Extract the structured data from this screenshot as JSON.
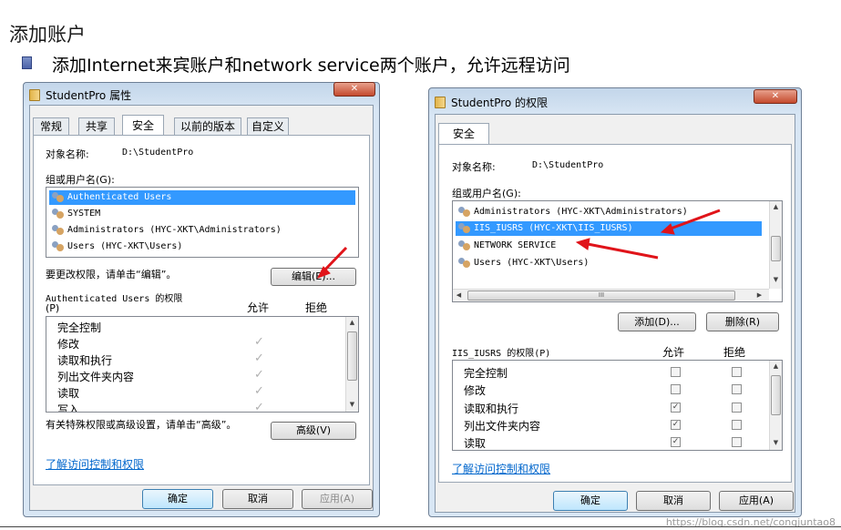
{
  "slide": {
    "title": "添加账户",
    "bullet": "添加Internet来宾账户和network service两个账户，允许远程访问"
  },
  "left_dialog": {
    "title": "StudentPro 属性",
    "close": "✕",
    "tabs": [
      "常规",
      "共享",
      "安全",
      "以前的版本",
      "自定义"
    ],
    "object_label": "对象名称:",
    "object_value": "D:\\StudentPro",
    "group_label": "组或用户名(G):",
    "users": [
      "Authenticated Users",
      "SYSTEM",
      "Administrators (HYC-XKT\\Administrators)",
      "Users (HYC-XKT\\Users)"
    ],
    "change_hint": "要更改权限，请单击“编辑”。",
    "edit_button": "编辑(E)...",
    "perm_title": "Authenticated Users 的权限",
    "perm_title_shortcut": "(P)",
    "col_allow": "允许",
    "col_deny": "拒绝",
    "permissions": [
      "完全控制",
      "修改",
      "读取和执行",
      "列出文件夹内容",
      "读取",
      "写入"
    ],
    "special_hint": "有关特殊权限或高级设置，请单击“高级”。",
    "advanced_button": "高级(V)",
    "link": "了解访问控制和权限",
    "ok": "确定",
    "cancel": "取消",
    "apply": "应用(A)"
  },
  "right_dialog": {
    "title": "StudentPro 的权限",
    "close": "✕",
    "tab": "安全",
    "object_label": "对象名称:",
    "object_value": "D:\\StudentPro",
    "group_label": "组或用户名(G):",
    "users": [
      "Administrators (HYC-XKT\\Administrators)",
      "IIS_IUSRS (HYC-XKT\\IIS_IUSRS)",
      "NETWORK SERVICE",
      "Users (HYC-XKT\\Users)"
    ],
    "hscroll_grip": "III",
    "add_button": "添加(D)...",
    "remove_button": "删除(R)",
    "perm_title": "IIS_IUSRS 的权限(P)",
    "col_allow": "允许",
    "col_deny": "拒绝",
    "permissions": [
      "完全控制",
      "修改",
      "读取和执行",
      "列出文件夹内容",
      "读取"
    ],
    "allow_checked": [
      false,
      false,
      true,
      true,
      true
    ],
    "deny_checked": [
      false,
      false,
      false,
      false,
      false
    ],
    "link": "了解访问控制和权限",
    "ok": "确定",
    "cancel": "取消",
    "apply": "应用(A)"
  },
  "watermark": "https://blog.csdn.net/congjuntao8",
  "colors": {
    "selection": "#3399ff",
    "arrow": "#e0141a",
    "link": "#0066cc"
  }
}
